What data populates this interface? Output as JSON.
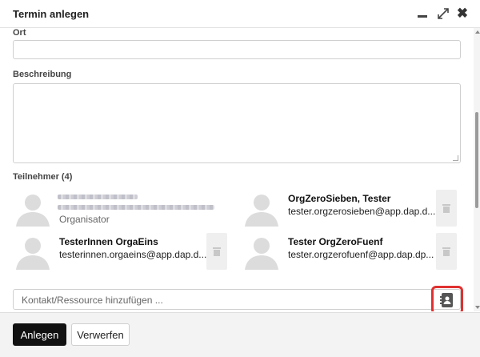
{
  "dialog": {
    "title": "Termin anlegen",
    "controls": {
      "minimize_icon": "minimize-icon",
      "expand_icon": "expand-icon",
      "close_label": "✖"
    }
  },
  "form": {
    "location_label": "Ort",
    "location_value": "",
    "description_label": "Beschreibung",
    "description_value": "",
    "participants_label": "Teilnehmer (4)",
    "participants": [
      {
        "name": "",
        "email": "",
        "role": "Organisator",
        "redacted": true,
        "removable": false
      },
      {
        "name": "OrgZeroSieben, Tester",
        "email": "tester.orgzerosieben@app.dap.d...",
        "role": "",
        "redacted": false,
        "removable": true
      },
      {
        "name": "TesterInnen OrgaEins",
        "email": "testerinnen.orgaeins@app.dap.d...",
        "role": "",
        "redacted": false,
        "removable": true
      },
      {
        "name": "Tester OrgZeroFuenf",
        "email": "tester.orgzerofuenf@app.dap.dp...",
        "role": "",
        "redacted": false,
        "removable": true
      }
    ],
    "contact_placeholder": "Kontakt/Ressource hinzufügen ...",
    "address_book_icon": "address-book-icon"
  },
  "footer": {
    "create_label": "Anlegen",
    "discard_label": "Verwerfen"
  },
  "colors": {
    "primary_button": "#111111",
    "highlight": "#e03131",
    "avatar": "#dcdcdc"
  }
}
